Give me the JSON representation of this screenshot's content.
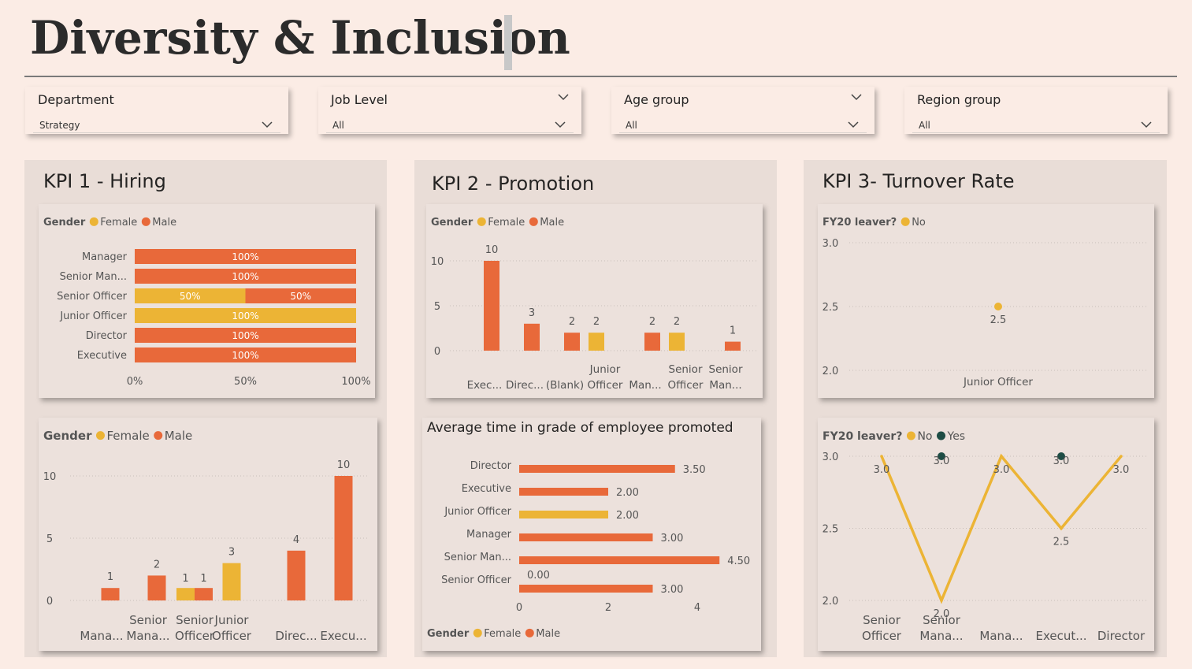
{
  "page": {
    "title": "Diversity & Inclusion"
  },
  "filters": [
    {
      "label": "Department",
      "value": "Strategy",
      "top_chevron": false
    },
    {
      "label": "Job Level",
      "value": "All",
      "top_chevron": true
    },
    {
      "label": "Age group",
      "value": "All",
      "top_chevron": true
    },
    {
      "label": "Region group",
      "value": "All",
      "top_chevron": false
    }
  ],
  "kpis": {
    "hiring_title": "KPI 1 - Hiring",
    "promotion_title": "KPI 2 - Promotion",
    "turnover_title": "KPI 3- Turnover Rate"
  },
  "colors": {
    "female": "#ecb435",
    "male": "#e8693a",
    "yes": "#1e4d45",
    "background": "#fbece5",
    "panel": "#e9ddd7"
  },
  "legends": {
    "gender_label": "Gender",
    "female": "Female",
    "male": "Male",
    "leaver_label": "FY20 leaver?",
    "no": "No",
    "yes": "Yes"
  },
  "chart_data": [
    {
      "id": "hiring_share",
      "type": "bar",
      "orientation": "horizontal",
      "stacked": "100%",
      "categories": [
        "Manager",
        "Senior Man...",
        "Senior Officer",
        "Junior Officer",
        "Director",
        "Executive"
      ],
      "series": [
        {
          "name": "Female",
          "values": [
            0,
            0,
            50,
            100,
            0,
            0
          ]
        },
        {
          "name": "Male",
          "values": [
            100,
            100,
            50,
            0,
            100,
            100
          ]
        }
      ],
      "xticks": [
        "0%",
        "50%",
        "100%"
      ],
      "xlim": [
        0,
        100
      ],
      "legend_title": "Gender",
      "legend": "top-left"
    },
    {
      "id": "hiring_count",
      "type": "bar",
      "stacked": true,
      "categories": [
        [
          "Mana..."
        ],
        [
          "Senior",
          "Mana..."
        ],
        [
          "Senior",
          "Officer"
        ],
        [
          "Junior",
          "Officer"
        ],
        [
          "Direc..."
        ],
        [
          "Execu..."
        ]
      ],
      "series": [
        {
          "name": "Female",
          "values": [
            0,
            0,
            1,
            3,
            0,
            0
          ]
        },
        {
          "name": "Male",
          "values": [
            1,
            2,
            1,
            0,
            4,
            10
          ]
        }
      ],
      "total_labels": [
        1,
        2,
        null,
        3,
        4,
        10
      ],
      "inside_labels": [
        null,
        null,
        [
          1,
          1
        ],
        null,
        null,
        null
      ],
      "yticks": [
        0,
        5,
        10
      ],
      "ylim": [
        0,
        10
      ],
      "grid": true,
      "legend_title": "Gender",
      "legend": "top-left"
    },
    {
      "id": "promotion_count",
      "type": "bar",
      "grouped": true,
      "categories": [
        [
          "Exec..."
        ],
        [
          "Direc..."
        ],
        [
          "(Blank)"
        ],
        [
          "Junior",
          "Officer"
        ],
        [
          "Man..."
        ],
        [
          "Senior",
          "Officer"
        ],
        [
          "Senior",
          "Man..."
        ]
      ],
      "bars": [
        {
          "group": 0,
          "series": "Male",
          "value": 10
        },
        {
          "group": 1,
          "series": "Male",
          "value": 3
        },
        {
          "group": 2,
          "series": "Male",
          "value": 2
        },
        {
          "group": 3,
          "series": "Female",
          "value": 2
        },
        {
          "group": 4,
          "series": "Male",
          "value": 2
        },
        {
          "group": 5,
          "series": "Female",
          "value": 2
        },
        {
          "group": 6,
          "series": "Male",
          "value": 1
        }
      ],
      "yticks": [
        0,
        5,
        10
      ],
      "ylim": [
        0,
        10
      ],
      "grid": true,
      "legend_title": "Gender",
      "legend": "top-left"
    },
    {
      "id": "promotion_time",
      "type": "bar",
      "orientation": "horizontal",
      "title": "Average time in grade of employee promoted",
      "categories": [
        "Director",
        "Executive",
        "Junior Officer",
        "Manager",
        "Senior Man...",
        "Senior Officer"
      ],
      "bars": [
        {
          "category": 0,
          "series": "Male",
          "value": 3.5,
          "label": "3.50"
        },
        {
          "category": 1,
          "series": "Male",
          "value": 2.0,
          "label": "2.00"
        },
        {
          "category": 2,
          "series": "Female",
          "value": 2.0,
          "label": "2.00"
        },
        {
          "category": 3,
          "series": "Male",
          "value": 3.0,
          "label": "3.00"
        },
        {
          "category": 4,
          "series": "Male",
          "value": 4.5,
          "label": "4.50"
        },
        {
          "category": 5,
          "series": "Female",
          "value": 0.0,
          "label": "0.00"
        },
        {
          "category": 5,
          "series": "Male",
          "value": 3.0,
          "label": "3.00"
        }
      ],
      "xticks": [
        0,
        2,
        4
      ],
      "xlim": [
        0,
        4.6
      ],
      "legend_title": "Gender",
      "legend": "bottom-left"
    },
    {
      "id": "turnover_junior",
      "type": "scatter",
      "categories": [
        [
          "Junior Officer"
        ]
      ],
      "series": [
        {
          "name": "No",
          "values": [
            2.5
          ]
        }
      ],
      "point_labels": [
        "2.5"
      ],
      "yticks": [
        "3.0",
        "2.5",
        "2.0"
      ],
      "ylim": [
        2.0,
        3.0
      ],
      "grid": true,
      "legend_title": "FY20 leaver?",
      "legend": "top-left"
    },
    {
      "id": "turnover_line",
      "type": "line",
      "categories": [
        [
          "Senior",
          "Officer"
        ],
        [
          "Senior",
          "Mana..."
        ],
        [
          "Mana..."
        ],
        [
          "Execut..."
        ],
        [
          "Director"
        ]
      ],
      "series": [
        {
          "name": "No",
          "values": [
            3.0,
            2.0,
            3.0,
            2.5,
            3.0
          ],
          "labels": [
            "3.0",
            "2.0",
            "3.0",
            "2.5",
            "3.0"
          ]
        },
        {
          "name": "Yes",
          "values": [
            null,
            3.0,
            null,
            3.0,
            null
          ],
          "labels": [
            null,
            "3.0",
            null,
            "3.0",
            null
          ]
        }
      ],
      "yticks": [
        "3.0",
        "2.5",
        "2.0"
      ],
      "ylim": [
        2.0,
        3.0
      ],
      "grid": true,
      "legend_title": "FY20 leaver?",
      "legend": "top-left"
    }
  ]
}
